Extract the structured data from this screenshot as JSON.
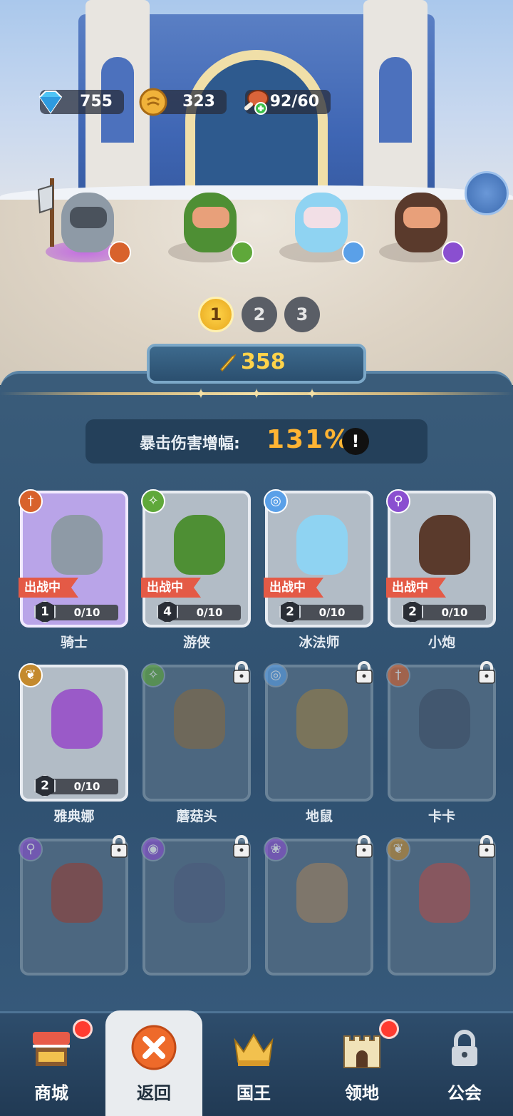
{
  "resources": {
    "gems": "755",
    "coins": "323",
    "stamina": "92/60"
  },
  "lineup_pages": [
    "1",
    "2",
    "3"
  ],
  "active_page": "1",
  "power": "358",
  "crit": {
    "label": "暴击伤害增幅:",
    "value": "131%",
    "info": "!"
  },
  "heroes": [
    {
      "name": "骑士",
      "status": "出战中",
      "level": "1",
      "progress": "0/10",
      "class_icon": "sword-class-icon",
      "color": "#d8622c"
    },
    {
      "name": "游侠",
      "status": "出战中",
      "level": "4",
      "progress": "0/10",
      "class_icon": "arrow-class-icon",
      "color": "#5fa83a"
    },
    {
      "name": "冰法师",
      "status": "出战中",
      "level": "2",
      "progress": "0/10",
      "class_icon": "spiral-class-icon",
      "color": "#5aa0e8"
    },
    {
      "name": "小炮",
      "status": "出战中",
      "level": "2",
      "progress": "0/10",
      "class_icon": "wand-class-icon",
      "color": "#8a4fd0"
    },
    {
      "name": "雅典娜",
      "status": "",
      "level": "2",
      "progress": "0/10",
      "class_icon": "wings-class-icon",
      "color": "#c48a2e"
    },
    {
      "name": "蘑菇头",
      "status": "",
      "level": "",
      "progress": "",
      "class_icon": "arrow-class-icon",
      "color": "#5fa83a"
    },
    {
      "name": "地鼠",
      "status": "",
      "level": "",
      "progress": "",
      "class_icon": "spiral-class-icon",
      "color": "#5aa0e8"
    },
    {
      "name": "卡卡",
      "status": "",
      "level": "",
      "progress": "",
      "class_icon": "sword-class-icon",
      "color": "#d8622c"
    },
    {
      "name": "",
      "status": "",
      "level": "",
      "progress": "",
      "class_icon": "wand-class-icon",
      "color": "#8a4fd0"
    },
    {
      "name": "",
      "status": "",
      "level": "",
      "progress": "",
      "class_icon": "eye-class-icon",
      "color": "#8a4fd0"
    },
    {
      "name": "",
      "status": "",
      "level": "",
      "progress": "",
      "class_icon": "paw-class-icon",
      "color": "#8a4fd0"
    },
    {
      "name": "",
      "status": "",
      "level": "",
      "progress": "",
      "class_icon": "wings-class-icon",
      "color": "#c48a2e"
    }
  ],
  "nav": [
    {
      "label": "商城",
      "icon": "shop-icon",
      "badge": true
    },
    {
      "label": "返回",
      "icon": "close-icon",
      "badge": false
    },
    {
      "label": "国王",
      "icon": "crown-icon",
      "badge": false
    },
    {
      "label": "领地",
      "icon": "castle-icon",
      "badge": true
    },
    {
      "label": "公会",
      "icon": "lock-icon",
      "badge": false
    }
  ],
  "colors": {
    "panel": "#2f5070",
    "accent_gold": "#ffd34a",
    "crit_value": "#ffb433",
    "deploy_tag": "#e45a46",
    "badge_red": "#ff3b30"
  }
}
